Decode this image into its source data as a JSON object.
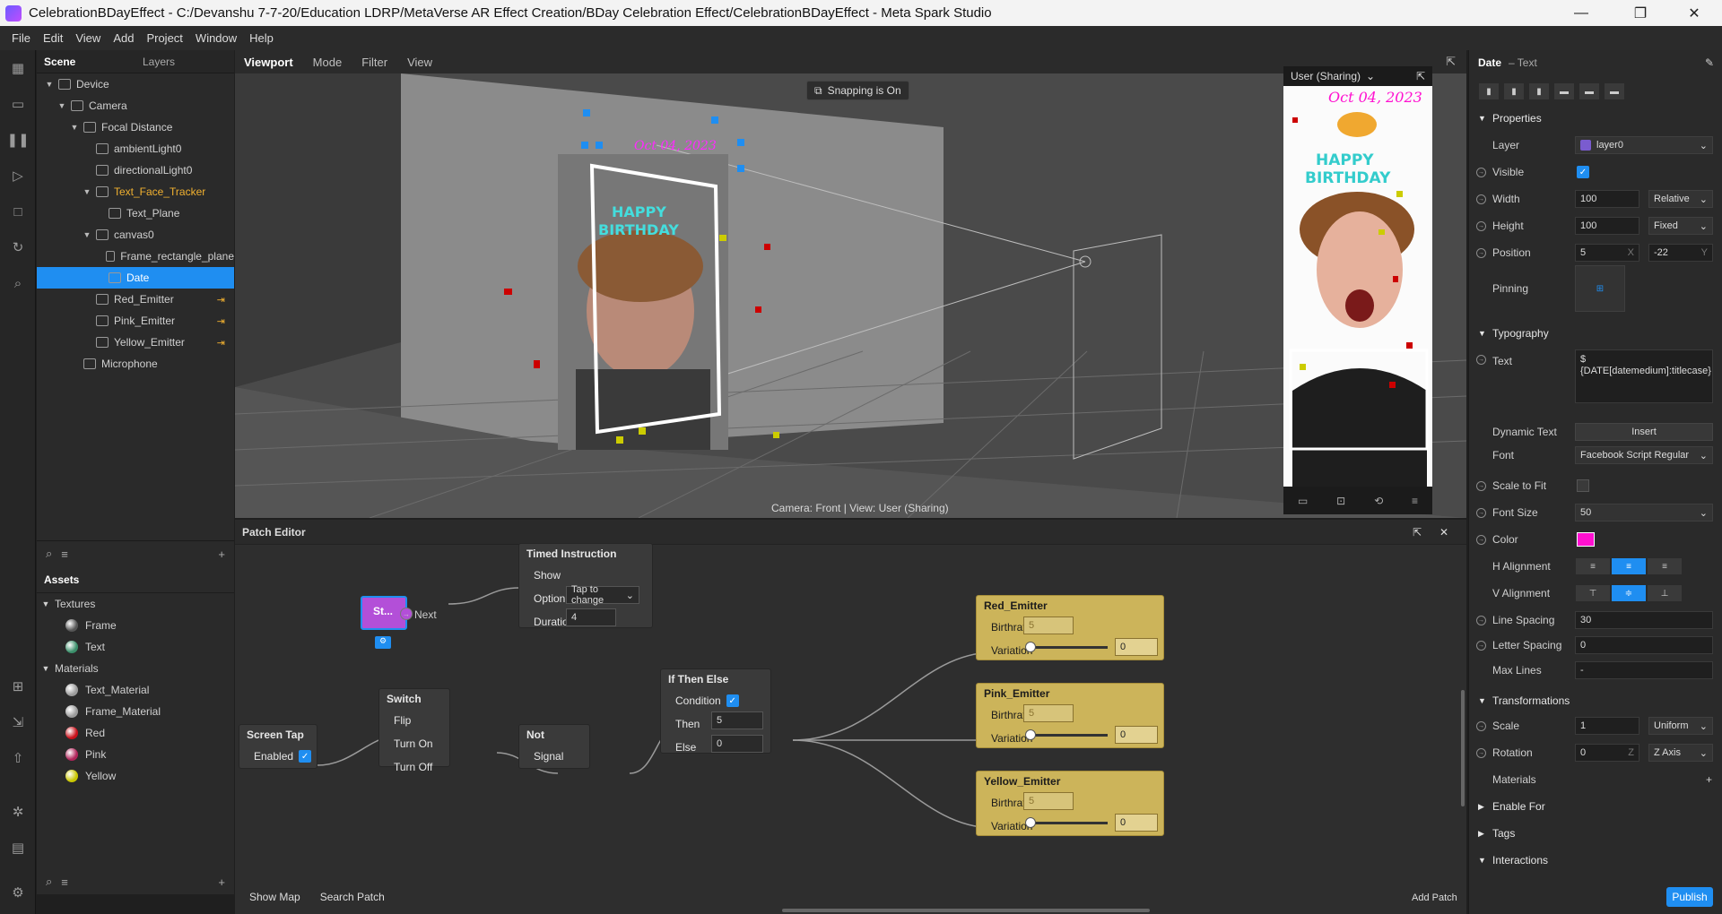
{
  "window": {
    "title": "CelebrationBDayEffect - C:/Devanshu 7-7-20/Education LDRP/MetaVerse AR Effect Creation/BDay Celebration Effect/CelebrationBDayEffect - Meta Spark Studio",
    "controls": {
      "minimize": "—",
      "restore": "❐",
      "close": "✕"
    }
  },
  "menu": [
    "File",
    "Edit",
    "View",
    "Add",
    "Project",
    "Window",
    "Help"
  ],
  "scene_panel": {
    "tabs": [
      "Scene",
      "Layers"
    ],
    "tree": [
      {
        "label": "Device",
        "depth": 0,
        "caret": "▼"
      },
      {
        "label": "Camera",
        "depth": 1,
        "caret": "▼"
      },
      {
        "label": "Focal Distance",
        "depth": 2,
        "caret": "▼"
      },
      {
        "label": "ambientLight0",
        "depth": 3,
        "caret": ""
      },
      {
        "label": "directionalLight0",
        "depth": 3,
        "caret": ""
      },
      {
        "label": "Text_Face_Tracker",
        "depth": 3,
        "caret": "▼",
        "amber": true
      },
      {
        "label": "Text_Plane",
        "depth": 4,
        "caret": ""
      },
      {
        "label": "canvas0",
        "depth": 3,
        "caret": "▼"
      },
      {
        "label": "Frame_rectangle_plane",
        "depth": 4,
        "caret": ""
      },
      {
        "label": "Date",
        "depth": 4,
        "caret": "",
        "selected": true
      },
      {
        "label": "Red_Emitter",
        "depth": 3,
        "caret": "",
        "link": "⇥"
      },
      {
        "label": "Pink_Emitter",
        "depth": 3,
        "caret": "",
        "link": "⇥"
      },
      {
        "label": "Yellow_Emitter",
        "depth": 3,
        "caret": "",
        "link": "⇥"
      },
      {
        "label": "Microphone",
        "depth": 2,
        "caret": ""
      }
    ]
  },
  "assets_panel": {
    "title": "Assets",
    "groups": [
      {
        "label": "Textures",
        "items": [
          {
            "label": "Frame",
            "color": "#555555"
          },
          {
            "label": "Text",
            "color": "#3a8f6a"
          }
        ]
      },
      {
        "label": "Materials",
        "items": [
          {
            "label": "Text_Material",
            "color": "#9a9a9a"
          },
          {
            "label": "Frame_Material",
            "color": "#9a9a9a"
          },
          {
            "label": "Red",
            "color": "#c8101a"
          },
          {
            "label": "Pink",
            "color": "#b0245a"
          },
          {
            "label": "Yellow",
            "color": "#c9c600"
          }
        ]
      }
    ]
  },
  "viewport": {
    "tabs": [
      "Viewport",
      "Mode",
      "Filter",
      "View"
    ],
    "snapping": "Snapping is On",
    "camera_label": "Camera: Front | View: User (Sharing)",
    "preview_title": "User (Sharing)",
    "overlay_date": "Oct 04, 2023",
    "happy": "HAPPY",
    "birthday": "BIRTHDAY"
  },
  "patch_editor": {
    "title": "Patch Editor",
    "start_node": "St...",
    "next_label": "Next",
    "timed": {
      "title": "Timed Instruction",
      "show": "Show",
      "option": "Option",
      "option_value": "Tap to change",
      "duration": "Duration",
      "duration_value": "4"
    },
    "screen_tap": {
      "title": "Screen Tap",
      "enabled": "Enabled"
    },
    "switch": {
      "title": "Switch",
      "flip": "Flip",
      "turn_on": "Turn On",
      "turn_off": "Turn Off"
    },
    "not": {
      "title": "Not",
      "signal": "Signal"
    },
    "ifthen": {
      "title": "If Then Else",
      "condition": "Condition",
      "then": "Then",
      "then_value": "5",
      "else": "Else",
      "else_value": "0"
    },
    "emitters": [
      {
        "title": "Red_Emitter",
        "birthrate": "Birthrate",
        "birthrate_value": "5",
        "variation": "Variation",
        "variation_value": "0"
      },
      {
        "title": "Pink_Emitter",
        "birthrate": "Birthrate",
        "birthrate_value": "5",
        "variation": "Variation",
        "variation_value": "0"
      },
      {
        "title": "Yellow_Emitter",
        "birthrate": "Birthrate",
        "birthrate_value": "5",
        "variation": "Variation",
        "variation_value": "0"
      }
    ],
    "footer": {
      "show_map": "Show Map",
      "search_patch": "Search Patch",
      "add_patch": "Add Patch"
    }
  },
  "properties": {
    "title": "Date",
    "subtitle": "– Text",
    "sections": {
      "properties": "Properties",
      "typography": "Typography",
      "transformations": "Transformations"
    },
    "layer": {
      "label": "Layer",
      "value": "layer0",
      "swatch": "#7a5ccf"
    },
    "visible": "Visible",
    "width": {
      "label": "Width",
      "value": "100",
      "mode": "Relative"
    },
    "height": {
      "label": "Height",
      "value": "100",
      "mode": "Fixed"
    },
    "position": {
      "label": "Position",
      "x": "5",
      "y": "-22",
      "x_axis": "X",
      "y_axis": "Y"
    },
    "pinning": "Pinning",
    "text": {
      "label": "Text",
      "value": "$ {DATE[datemedium]:titlecase}"
    },
    "dynamic_text": {
      "label": "Dynamic Text",
      "button": "Insert"
    },
    "font": {
      "label": "Font",
      "value": "Facebook Script Regular"
    },
    "scale_to_fit": "Scale to Fit",
    "font_size": {
      "label": "Font Size",
      "value": "50"
    },
    "color": {
      "label": "Color",
      "value": "#ff10d0"
    },
    "h_alignment": "H Alignment",
    "v_alignment": "V Alignment",
    "line_spacing": {
      "label": "Line Spacing",
      "value": "30"
    },
    "letter_spacing": {
      "label": "Letter Spacing",
      "value": "0"
    },
    "max_lines": {
      "label": "Max Lines",
      "value": "-"
    },
    "scale": {
      "label": "Scale",
      "value": "1",
      "mode": "Uniform"
    },
    "rotation": {
      "label": "Rotation",
      "value": "0",
      "axis_tag": "Z",
      "axis": "Z Axis"
    },
    "materials": "Materials",
    "enable_for": "Enable For",
    "tags": "Tags",
    "interactions": "Interactions",
    "publish": "Publish"
  }
}
